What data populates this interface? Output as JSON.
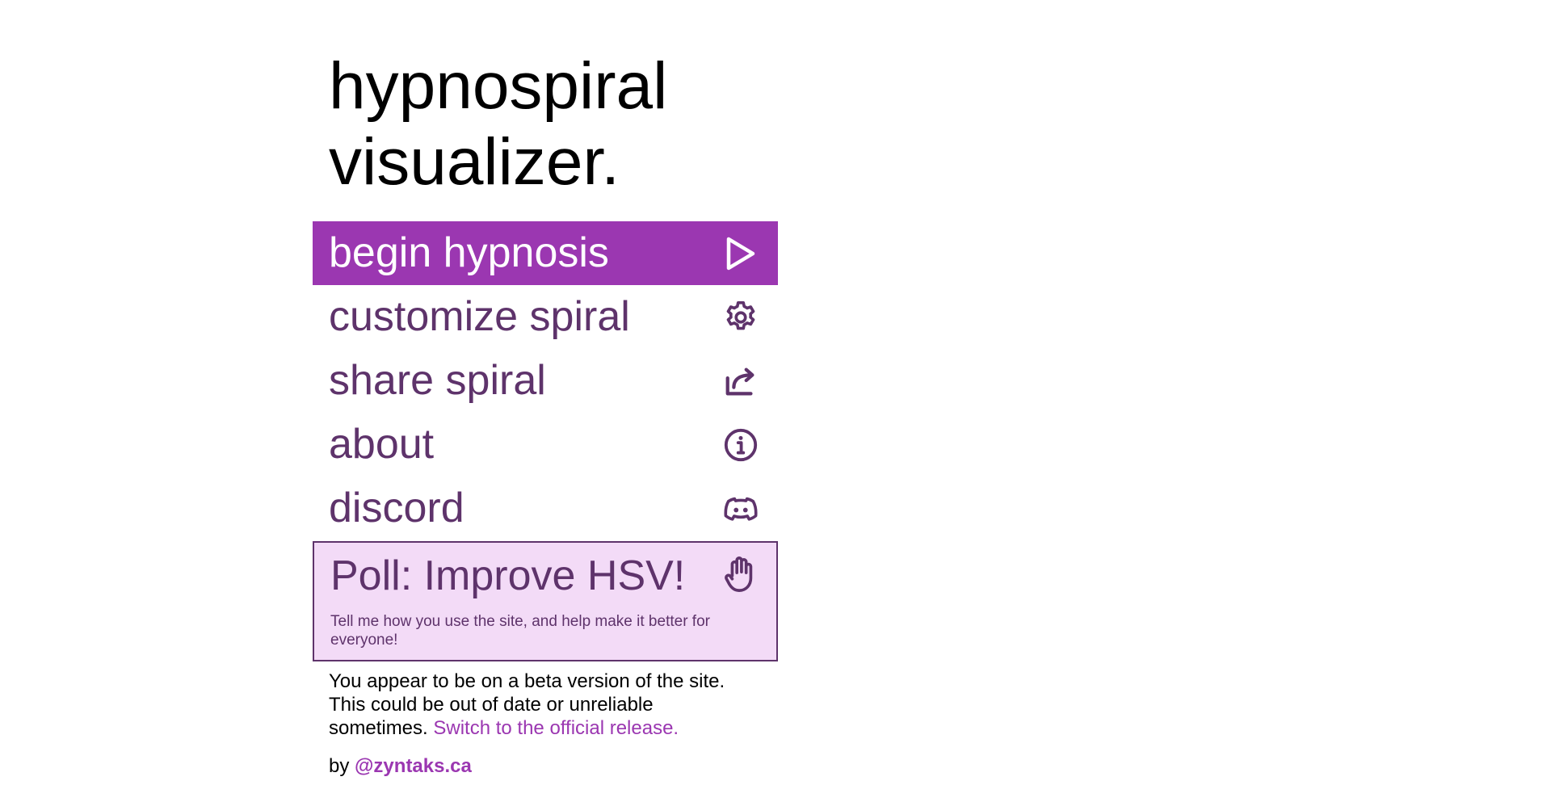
{
  "app": {
    "title_line1": "hypnospiral",
    "title_line2": "visualizer."
  },
  "menu": {
    "begin": {
      "label": "begin hypnosis",
      "icon": "play-icon"
    },
    "customize": {
      "label": "customize spiral",
      "icon": "gear-icon"
    },
    "share": {
      "label": "share spiral",
      "icon": "share-icon"
    },
    "about": {
      "label": "about",
      "icon": "info-icon"
    },
    "discord": {
      "label": "discord",
      "icon": "discord-icon"
    }
  },
  "poll": {
    "title": "Poll: Improve HSV!",
    "description": "Tell me how you use the site, and help make it better for everyone!",
    "icon": "hand-icon"
  },
  "beta_notice": {
    "text": "You appear to be on a beta version of the site. This could be out of date or unreliable sometimes.",
    "link_text": "Switch to the official release."
  },
  "credit": {
    "prefix": "by",
    "author": "@zyntaks.ca"
  },
  "colors": {
    "accent": "#9b37b1",
    "text_purple": "#5e336b",
    "poll_background": "#f3dbf7",
    "background": "#ffffff"
  }
}
